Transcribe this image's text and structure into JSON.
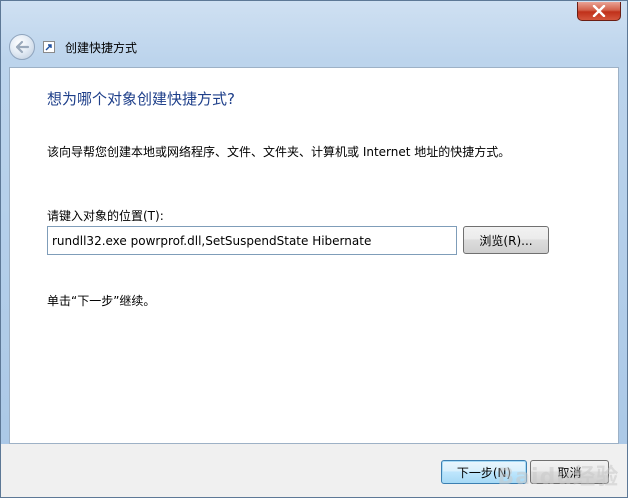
{
  "window": {
    "title": "创建快捷方式",
    "close_icon": "close-icon"
  },
  "nav": {
    "back_icon": "back-arrow-icon",
    "shortcut_icon": "shortcut-arrow-icon"
  },
  "page": {
    "heading": "想为哪个对象创建快捷方式?",
    "description": "该向导帮您创建本地或网络程序、文件、文件夹、计算机或 Internet 地址的快捷方式。",
    "location_label": "请键入对象的位置(T):",
    "location_value": "rundll32.exe powrprof.dll,SetSuspendState Hibernate",
    "browse_label": "浏览(R)...",
    "hint": "单击“下一步”继续。"
  },
  "footer": {
    "next_label": "下一步(N)",
    "cancel_label": "取消"
  },
  "watermark": "Baidu经验",
  "colors": {
    "heading": "#1e3f8a",
    "close_button": "#c0301a",
    "frame": "#a9c7e6"
  }
}
